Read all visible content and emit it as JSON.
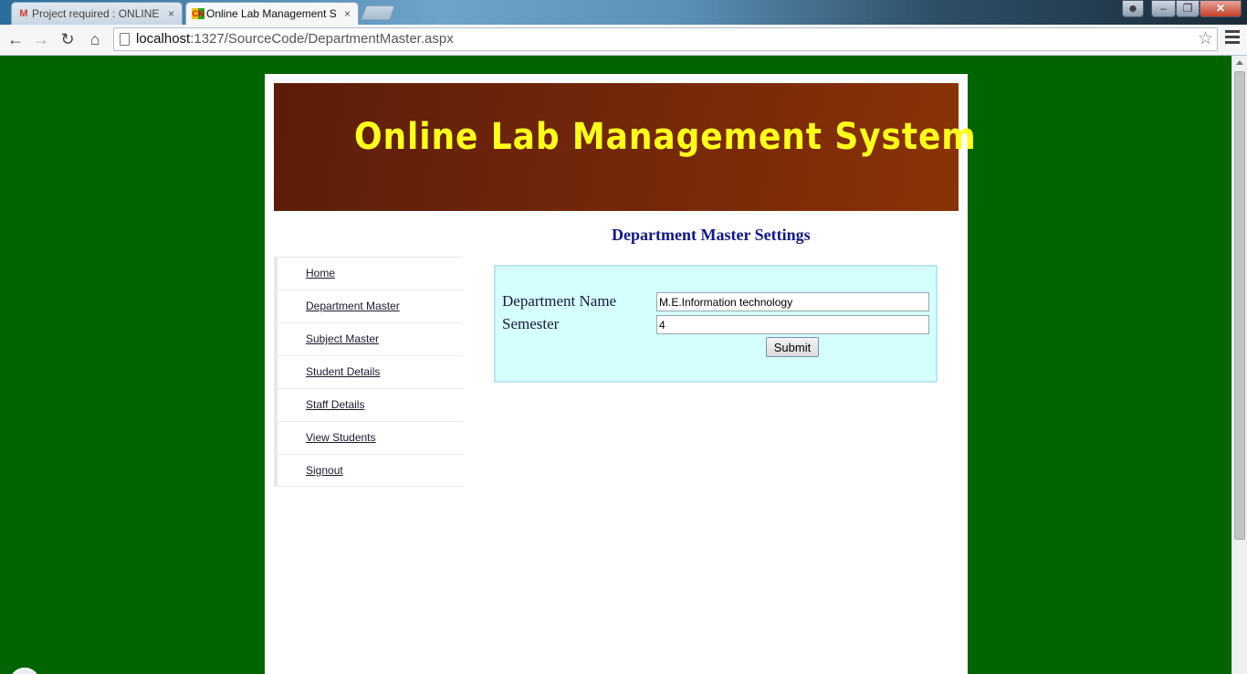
{
  "browser": {
    "tabs": [
      {
        "title": "Project required : ONLINE",
        "icon": "gmail-icon",
        "active": false
      },
      {
        "title": "Online Lab Management S",
        "icon": "site-favicon",
        "active": true
      }
    ],
    "close_glyph": "×",
    "url_host": "localhost",
    "url_rest": ":1327/SourceCode/DepartmentMaster.aspx"
  },
  "header": {
    "banner_title": "Online Lab Management System"
  },
  "page": {
    "heading": "Department Master Settings"
  },
  "sidebar": {
    "items": [
      {
        "label": "Home"
      },
      {
        "label": "Department Master"
      },
      {
        "label": "Subject Master"
      },
      {
        "label": "Student Details"
      },
      {
        "label": "Staff Details"
      },
      {
        "label": "View Students"
      },
      {
        "label": "Signout"
      }
    ]
  },
  "form": {
    "department_label": "Department Name",
    "department_value": "M.E.Information technology",
    "semester_label": "Semester",
    "semester_value": "4",
    "submit_label": "Submit"
  },
  "colors": {
    "page_background": "#006400",
    "banner_title": "#ffff1a",
    "heading": "#0f1787",
    "form_background": "#d4fffe"
  }
}
